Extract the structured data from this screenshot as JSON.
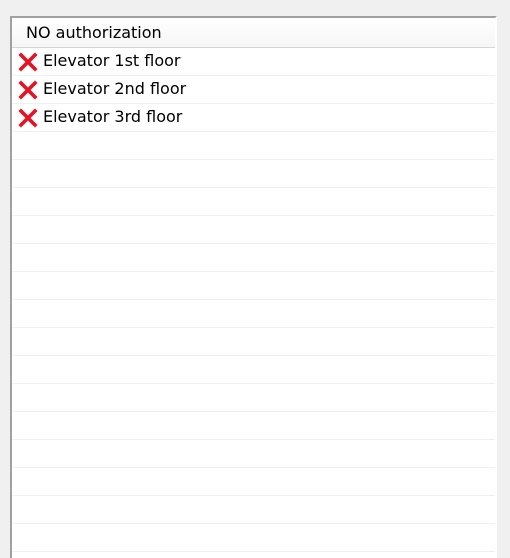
{
  "list": {
    "column_header": "NO authorization",
    "items": [
      {
        "label": "Elevator 1st floor",
        "icon": "red-x-icon"
      },
      {
        "label": "Elevator 2nd floor",
        "icon": "red-x-icon"
      },
      {
        "label": "Elevator 3rd floor",
        "icon": "red-x-icon"
      }
    ],
    "empty_row_count": 16
  },
  "colors": {
    "icon_red": "#e81123",
    "header_border": "#9a9a9a",
    "row_divider": "#f0f0f0"
  }
}
